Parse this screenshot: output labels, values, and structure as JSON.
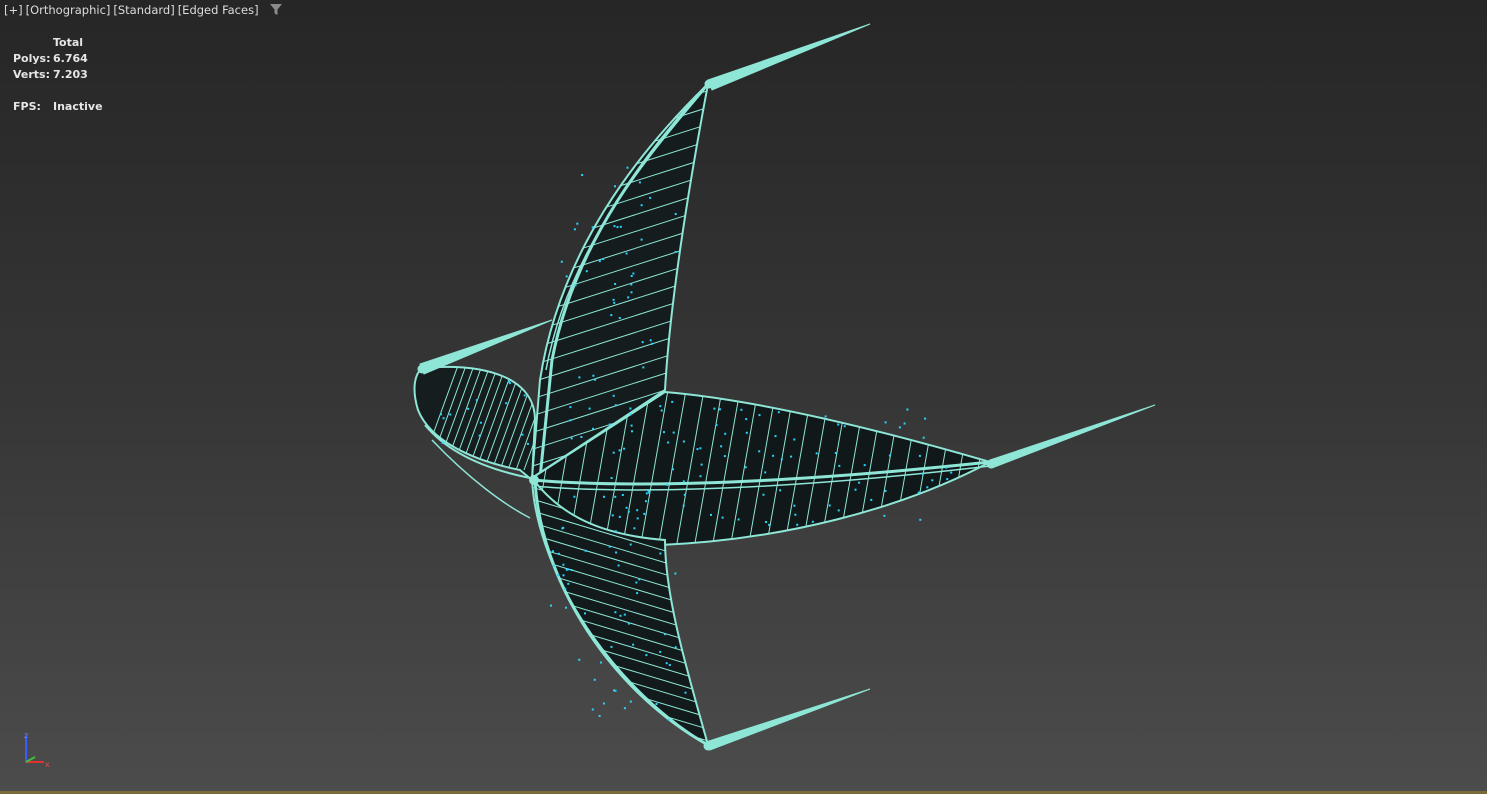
{
  "viewport_label": {
    "plus": "[+]",
    "view": "[Orthographic]",
    "shading": "[Standard]",
    "mode": "[Edged Faces]",
    "filter_icon": "filter-icon"
  },
  "stats": {
    "header": "Total",
    "polys_label": "Polys:",
    "polys_value": "6.764",
    "verts_label": "Verts:",
    "verts_value": "7.203",
    "fps_label": "FPS:",
    "fps_value": "Inactive"
  },
  "axis_gizmo": {
    "z": "z",
    "x": "x"
  },
  "colors": {
    "wireframe": "#8ee6d6",
    "panel_fill": "#121a1c",
    "lights": "#28d4ff",
    "axis_z": "#3a5cff",
    "axis_x": "#e03030",
    "axis_y": "#3ec03e"
  }
}
